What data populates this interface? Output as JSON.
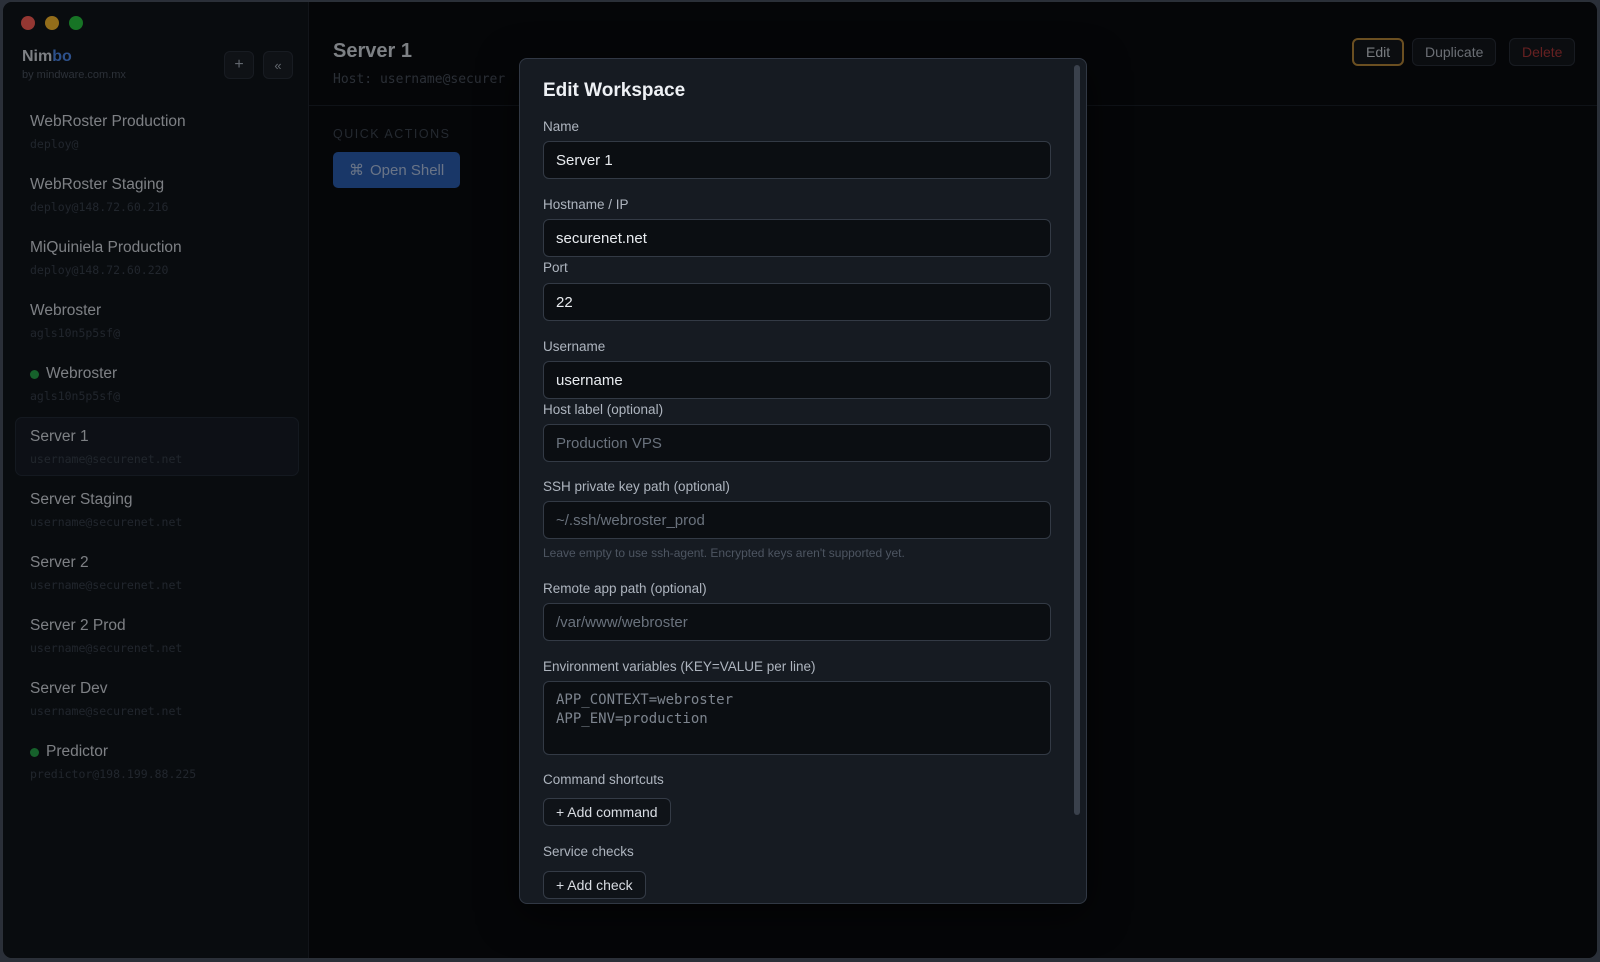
{
  "brand": {
    "name_main": "Nim",
    "name_accent": "bo",
    "subtitle": "by mindware.com.mx",
    "add_icon": "plus-icon",
    "collapse_icon": "double-chevron-left-icon",
    "add_glyph": "+",
    "collapse_glyph": "«"
  },
  "sidebar": {
    "items": [
      {
        "name": "WebRoster Production",
        "host": "deploy@",
        "online": false
      },
      {
        "name": "WebRoster Staging",
        "host": "deploy@148.72.60.216",
        "online": false
      },
      {
        "name": "MiQuiniela Production",
        "host": "deploy@148.72.60.220",
        "online": false
      },
      {
        "name": "Webroster",
        "host": "agls10n5p5sf@",
        "online": false
      },
      {
        "name": "Webroster",
        "host": "agls10n5p5sf@",
        "online": true
      },
      {
        "name": "Server 1",
        "host": "username@securenet.net",
        "online": false,
        "active": true
      },
      {
        "name": "Server Staging",
        "host": "username@securenet.net",
        "online": false
      },
      {
        "name": "Server 2",
        "host": "username@securenet.net",
        "online": false
      },
      {
        "name": "Server 2 Prod",
        "host": "username@securenet.net",
        "online": false
      },
      {
        "name": "Server Dev",
        "host": "username@securenet.net",
        "online": false
      },
      {
        "name": "Predictor",
        "host": "predictor@198.199.88.225",
        "online": true
      }
    ]
  },
  "header": {
    "title": "Server 1",
    "host": "Host: username@securer",
    "edit_label": "Edit",
    "duplicate_label": "Duplicate",
    "delete_label": "Delete"
  },
  "quick_actions": {
    "label": "QUICK ACTIONS",
    "open_shell_icon": "command-icon",
    "open_shell_glyph": "⌘",
    "open_shell_label": "Open Shell"
  },
  "modal": {
    "title": "Edit Workspace",
    "name_label": "Name",
    "name_value": "Server 1",
    "hostname_label": "Hostname / IP",
    "hostname_value": "securenet.net",
    "port_label": "Port",
    "port_value": "22",
    "username_label": "Username",
    "username_value": "username",
    "host_label_label": "Host label (optional)",
    "host_label_placeholder": "Production VPS",
    "ssh_key_label": "SSH private key path (optional)",
    "ssh_key_placeholder": "~/.ssh/webroster_prod",
    "ssh_key_help": "Leave empty to use ssh-agent. Encrypted keys aren't supported yet.",
    "remote_path_label": "Remote app path (optional)",
    "remote_path_placeholder": "/var/www/webroster",
    "env_label": "Environment variables (KEY=VALUE per line)",
    "env_placeholder": "APP_CONTEXT=webroster\nAPP_ENV=production",
    "commands_label": "Command shortcuts",
    "add_command_label": "+ Add command",
    "service_checks_label": "Service checks",
    "add_check_label": "+ Add check"
  },
  "colors": {
    "accent": "#4f8cf0",
    "primary_button": "#2c5fb3",
    "danger": "#b0383a",
    "edit_outline": "#b8883a",
    "online": "#27a84a"
  }
}
